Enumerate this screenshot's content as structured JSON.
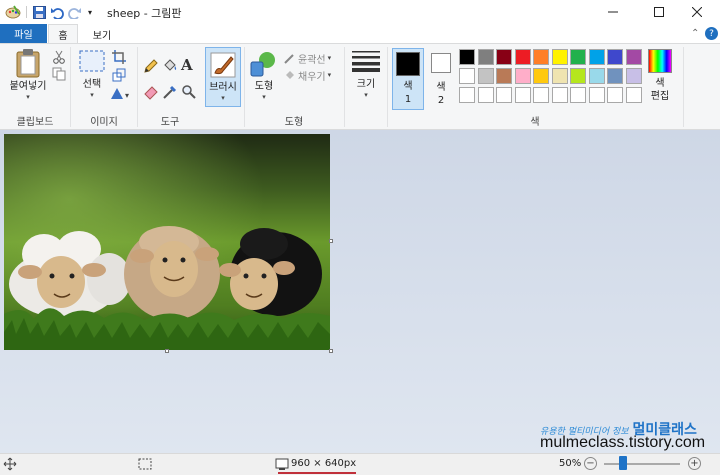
{
  "window": {
    "title": "sheep - 그림판"
  },
  "tabs": {
    "file": "파일",
    "home": "홈",
    "view": "보기"
  },
  "clipboard": {
    "paste": "붙여넣기",
    "group": "클립보드"
  },
  "image": {
    "select": "선택",
    "group": "이미지"
  },
  "tools": {
    "group": "도구",
    "text_tool": "A"
  },
  "brushes": {
    "label": "브러시"
  },
  "shapes": {
    "label": "도형",
    "outline": "윤곽선",
    "fill": "채우기",
    "group": "도형"
  },
  "size": {
    "label": "크기"
  },
  "colors": {
    "color1_line1": "색",
    "color1_line2": "1",
    "color2_line1": "색",
    "color2_line2": "2",
    "edit_line1": "색",
    "edit_line2": "편집",
    "group": "색",
    "color1": "#000000",
    "color2": "#ffffff",
    "palette_row1": [
      "#000000",
      "#7f7f7f",
      "#880015",
      "#ed1c24",
      "#ff7f27",
      "#fff200",
      "#22b14c",
      "#00a2e8",
      "#3f48cc",
      "#a349a4"
    ],
    "palette_row2": [
      "#ffffff",
      "#c3c3c3",
      "#b97a57",
      "#ffaec9",
      "#ffc90e",
      "#efe4b0",
      "#b5e61d",
      "#99d9ea",
      "#7092be",
      "#c8bfe7"
    ],
    "palette_row3": [
      "#ffffff",
      "#ffffff",
      "#ffffff",
      "#ffffff",
      "#ffffff",
      "#ffffff",
      "#ffffff",
      "#ffffff",
      "#ffffff",
      "#ffffff"
    ]
  },
  "status": {
    "dimensions": "960 × 640px",
    "zoom": "50%",
    "zoom_level": 0.25
  },
  "watermark": {
    "line1": "유용한 멀티미디어 정보",
    "brand": "멀미클래스",
    "url": "mulmeclass.tistory.com"
  }
}
